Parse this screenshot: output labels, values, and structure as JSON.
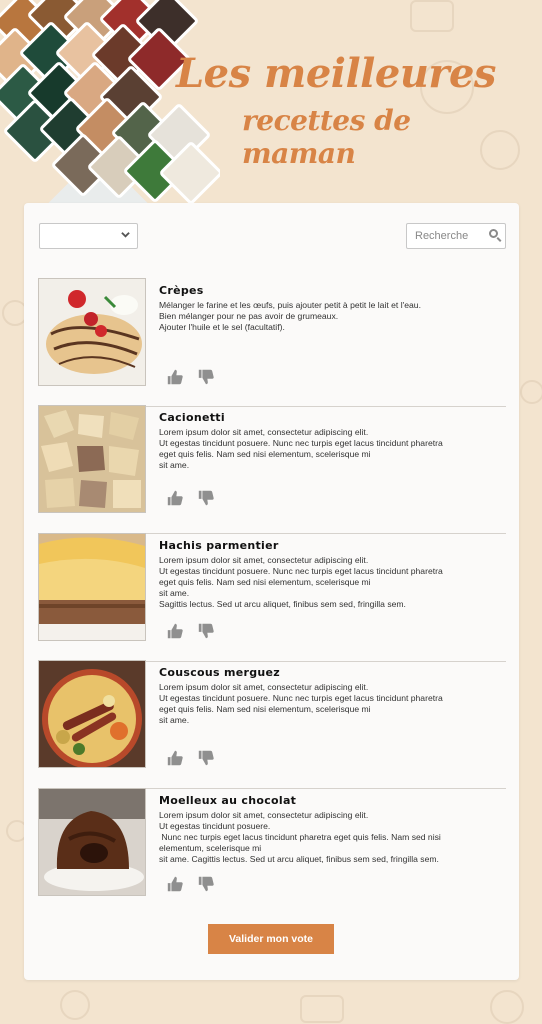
{
  "header": {
    "title_line1": "Les meilleures",
    "title_line2": "recettes de maman"
  },
  "filters": {
    "category_select_value": "",
    "search_placeholder": "Recherche"
  },
  "recipes": [
    {
      "name": "Crèpes",
      "description_lines": [
        "Mélanger le farine et les œufs, puis ajouter petit à petit le lait et l'eau.",
        "Bien mélanger pour ne pas avoir de grumeaux.",
        "Ajouter l'huile et le sel (facultatif)."
      ]
    },
    {
      "name": "Cacionetti",
      "description_lines": [
        "Lorem ipsum dolor sit amet, consectetur adipiscing elit.",
        "Ut egestas tincidunt posuere. Nunc nec turpis eget lacus tincidunt pharetra",
        "eget quis felis. Nam sed nisi elementum, scelerisque mi",
        "sit ame."
      ]
    },
    {
      "name": "Hachis parmentier",
      "description_lines": [
        "Lorem ipsum dolor sit amet, consectetur adipiscing elit.",
        "Ut egestas tincidunt posuere. Nunc nec turpis eget lacus tincidunt pharetra",
        "eget quis felis. Nam sed nisi elementum, scelerisque mi",
        "sit ame.",
        "Sagittis lectus. Sed ut arcu aliquet, finibus sem sed, fringilla sem."
      ]
    },
    {
      "name": "Couscous merguez",
      "description_lines": [
        "Lorem ipsum dolor sit amet, consectetur adipiscing elit.",
        "Ut egestas tincidunt posuere. Nunc nec turpis eget lacus tincidunt pharetra",
        "eget quis felis. Nam sed nisi elementum, scelerisque mi",
        "sit ame."
      ]
    },
    {
      "name": "Moelleux au chocolat",
      "description_lines": [
        "Lorem ipsum dolor sit amet, consectetur adipiscing elit.",
        "Ut egestas tincidunt posuere.",
        " Nunc nec turpis eget lacus tincidunt pharetra eget quis felis. Nam sed nisi",
        "elementum, scelerisque mi",
        "sit ame. Cagittis lectus. Sed ut arcu aliquet, finibus sem sed, fringilla sem."
      ]
    }
  ],
  "submit_label": "Valider mon vote",
  "icons": {
    "like": "thumbs-up-icon",
    "dislike": "thumbs-down-icon",
    "search": "search-icon",
    "dropdown": "chevron-down-icon"
  },
  "colors": {
    "accent": "#d88446",
    "background": "#f3e4cf",
    "card": "#fbfaf9",
    "vote_icon": "#8f8f8f"
  }
}
